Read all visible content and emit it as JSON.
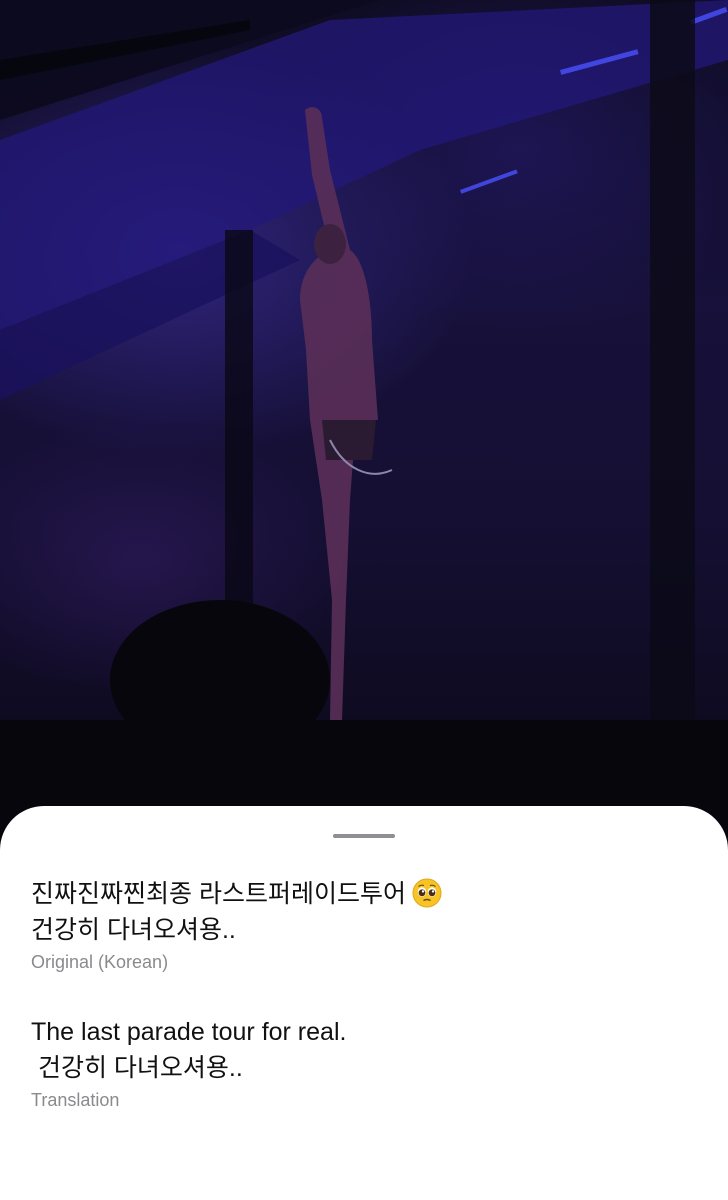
{
  "photo": {
    "alt": ""
  },
  "sheet": {
    "original": {
      "line1": "진짜진짜찐최종 라스트퍼레이드투어",
      "emoji": "pleading-face-emoji",
      "line2": "건강히 다녀오셔용..",
      "label": "Original (Korean)"
    },
    "translation": {
      "line1": "The last parade tour for real.",
      "line2": " 건강히 다녀오셔용..",
      "label": "Translation"
    }
  },
  "colors": {
    "sheet_background": "#ffffff",
    "text_primary": "#111111",
    "text_secondary": "#8a8a8e",
    "grabber": "#8e8e93",
    "stage_blue": "#2a1f7a"
  }
}
